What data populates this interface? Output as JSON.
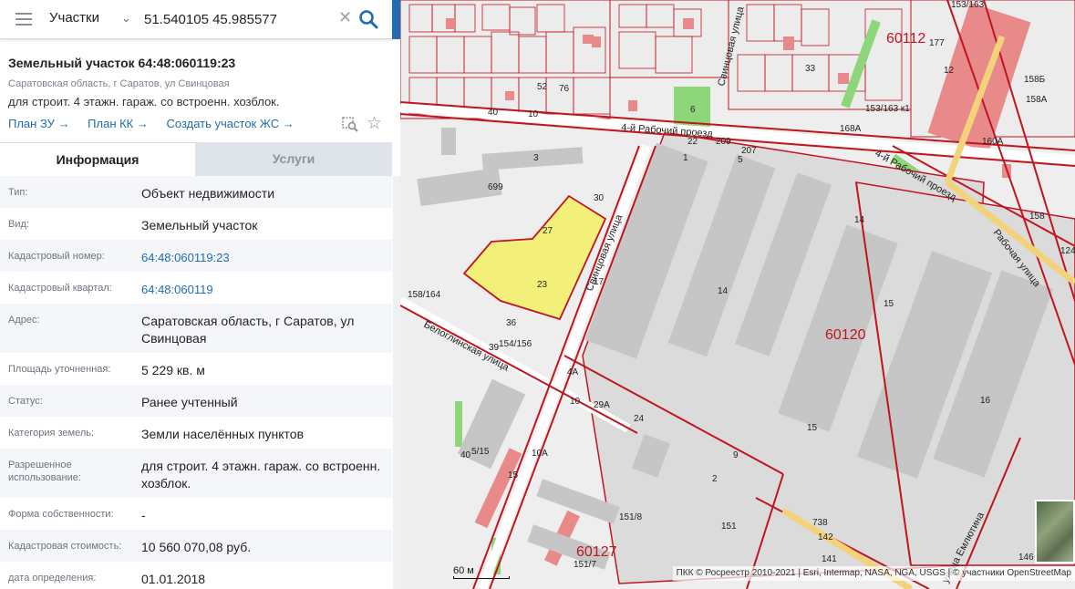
{
  "search": {
    "type_label": "Участки",
    "query": "51.540105 45.985577"
  },
  "object": {
    "title": "Земельный участок 64:48:060119:23",
    "address": "Саратовская область, г Саратов, ул Свинцовая",
    "purpose": "для строит. 4 этажн. гараж. со встроенн. хозблок.",
    "links": [
      "План ЗУ →",
      "План КК →",
      "Создать участок ЖС →"
    ]
  },
  "tabs": [
    {
      "label": "Информация",
      "active": true
    },
    {
      "label": "Услуги",
      "active": false
    }
  ],
  "rows": [
    {
      "label": "Тип:",
      "value": "Объект недвижимости"
    },
    {
      "label": "Вид:",
      "value": "Земельный участок"
    },
    {
      "label": "Кадастровый номер:",
      "value": "64:48:060119:23",
      "link": true
    },
    {
      "label": "Кадастровый квартал:",
      "value": "64:48:060119",
      "link": true
    },
    {
      "label": "Адрес:",
      "value": "Саратовская область, г Саратов, ул Свинцовая"
    },
    {
      "label": "Площадь уточненная:",
      "value": "5 229 кв. м"
    },
    {
      "label": "Статус:",
      "value": "Ранее учтенный"
    },
    {
      "label": "Категория земель:",
      "value": "Земли населённых пунктов"
    },
    {
      "label": "Разрешенное использование:",
      "value": "для строит. 4 этажн. гараж. со встроенн. хозблок."
    },
    {
      "label": "Форма собственности:",
      "value": "-"
    },
    {
      "label": "Кадастровая стоимость:",
      "value": "10 560 070,08 руб."
    },
    {
      "label": "дата определения:",
      "value": "01.01.2018"
    }
  ],
  "map": {
    "streets": {
      "rabochiy_4": "4-й Рабочий проезд",
      "rabochiy_4b": "4-й Рабочий проезд",
      "svintsovaya": "Свинцовая улица",
      "svintsovaya_top": "Свинцовая улица",
      "rabochaya": "Рабочая улица",
      "belogl": "Белоглинская улица",
      "emlyutina": "улица Емлютина"
    },
    "blocks": [
      "60112",
      "60120",
      "60127"
    ],
    "parcels": [
      "23",
      "14",
      "15",
      "16",
      "699",
      "3",
      "30",
      "27",
      "17",
      "36",
      "39",
      "154/156",
      "158/164",
      "4А",
      "10",
      "29А",
      "24",
      "6",
      "9",
      "40",
      "5/15",
      "15",
      "10А",
      "151/8",
      "151/7",
      "177",
      "12",
      "153/163",
      "153/163 к1",
      "168А",
      "158Б",
      "158А",
      "160А",
      "158",
      "124",
      "33",
      "52",
      "76",
      "40",
      "10",
      "209",
      "207",
      "22",
      "1",
      "5",
      "2",
      "151",
      "142",
      "141",
      "146",
      "738"
    ],
    "scale_label": "60 м",
    "attribution": "ПКК © Росреестр 2010-2021 | Esri, Intermap, NASA, NGA, USGS | © участники OpenStreetMap",
    "colors": {
      "parcel_highlight": "#f3f07a",
      "boundary": "#c0151f",
      "building": "#c6c6c6",
      "residential": "#e88a8a",
      "green": "#8ed67a"
    }
  }
}
